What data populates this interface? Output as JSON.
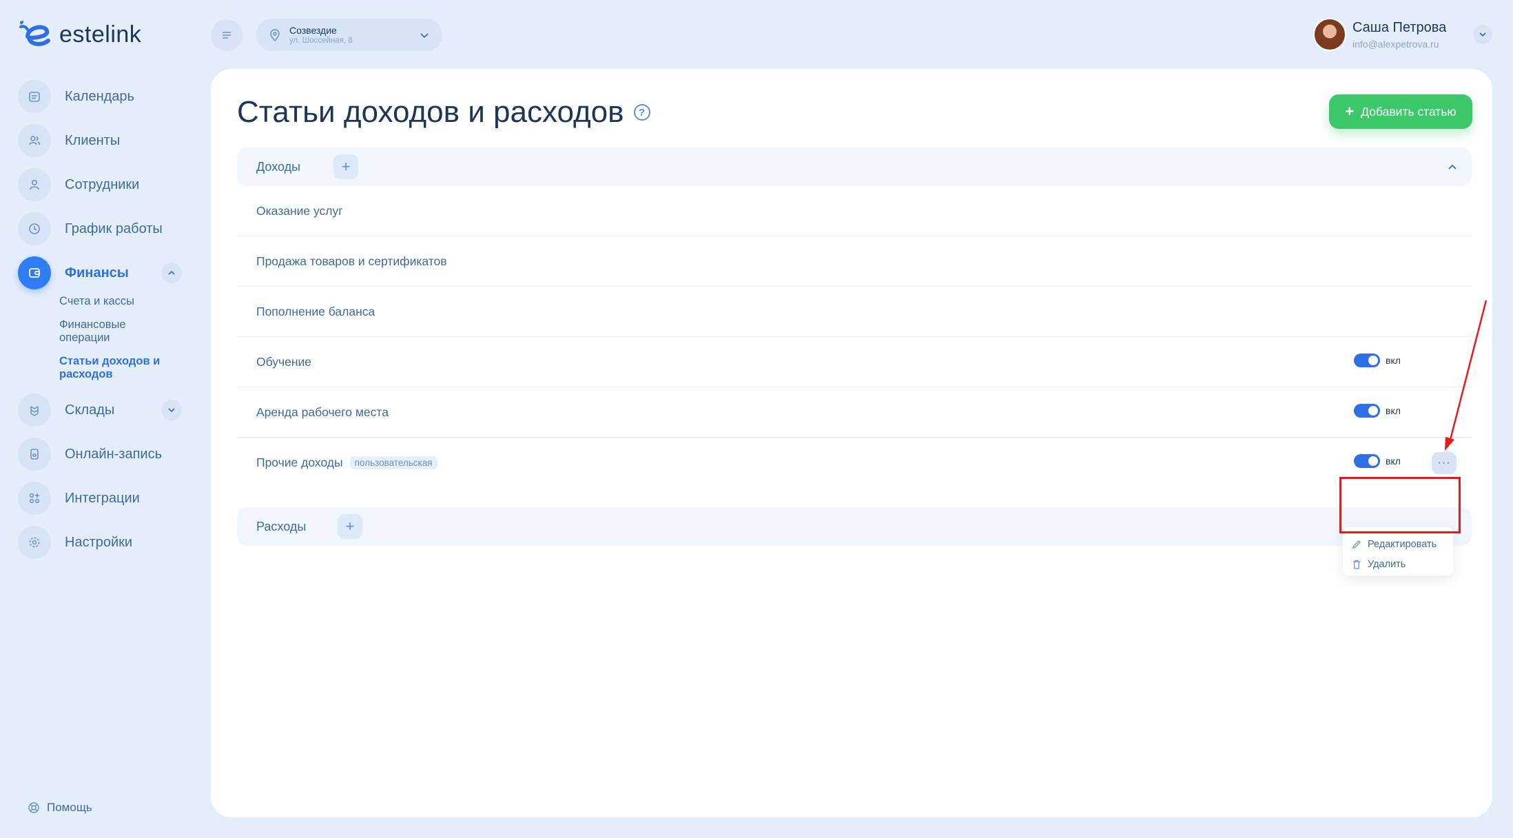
{
  "brand": {
    "name": "estelink"
  },
  "sidebar": {
    "items": [
      {
        "label": "Календарь",
        "icon": "calendar-icon"
      },
      {
        "label": "Клиенты",
        "icon": "clients-icon"
      },
      {
        "label": "Сотрудники",
        "icon": "employee-icon"
      },
      {
        "label": "График работы",
        "icon": "clock-icon"
      },
      {
        "label": "Финансы",
        "icon": "wallet-icon",
        "active": true,
        "expanded": true
      },
      {
        "label": "Склады",
        "icon": "warehouse-icon",
        "expanded": false
      },
      {
        "label": "Онлайн-запись",
        "icon": "online-booking-icon"
      },
      {
        "label": "Интеграции",
        "icon": "integrations-icon"
      },
      {
        "label": "Настройки",
        "icon": "gear-icon"
      }
    ],
    "finance_sub": [
      {
        "label": "Счета и кассы",
        "active": false
      },
      {
        "label": "Финансовые операции",
        "active": false
      },
      {
        "label": "Статьи доходов и расходов",
        "active": true
      }
    ],
    "help": "Помощь"
  },
  "header": {
    "branch_name": "Созвездие",
    "branch_address": "ул. Шоссейная, 8",
    "user_name": "Саша Петрова",
    "user_email": "info@alexpetrova.ru"
  },
  "main": {
    "title": "Статьи доходов и расходов",
    "add_button": "Добавить статью",
    "income": {
      "label": "Доходы",
      "rows": [
        {
          "label": "Оказание услуг"
        },
        {
          "label": "Продажа товаров и сертификатов"
        },
        {
          "label": "Пополнение баланса"
        },
        {
          "label": "Обучение",
          "toggle": "вкл",
          "enabled": true
        },
        {
          "label": "Аренда рабочего места",
          "toggle": "вкл",
          "enabled": true
        },
        {
          "label": "Прочие доходы",
          "badge": "пользовательская",
          "toggle": "вкл",
          "enabled": true
        }
      ]
    },
    "expenses": {
      "label": "Расходы"
    },
    "row_menu": {
      "edit": "Редактировать",
      "delete": "Удалить"
    }
  },
  "colors": {
    "accent": "#2f7cf6",
    "add_button": "#3cc769",
    "annotation": "#e31b1b",
    "background": "#e4eefb"
  }
}
